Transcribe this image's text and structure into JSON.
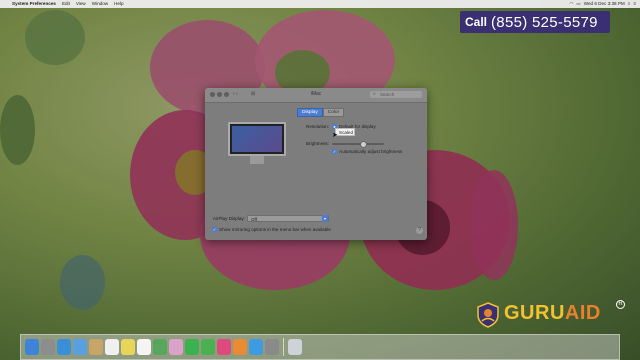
{
  "menubar": {
    "app_name": "System Preferences",
    "items": [
      "Edit",
      "View",
      "Window",
      "Help"
    ],
    "clock": "Wed 6 Dec  3:38 PM"
  },
  "banner": {
    "call_label": "Call",
    "phone": "(855)  525-5579"
  },
  "window": {
    "title": "iMac",
    "search_placeholder": "Search",
    "tabs": [
      {
        "label": "Display",
        "active": true
      },
      {
        "label": "Color",
        "active": false
      }
    ],
    "resolution_label": "Resolution:",
    "default_option": "Default for display",
    "scaled_option": "Scaled",
    "brightness_label": "Brightness:",
    "brightness_level": 0.62,
    "auto_brightness_label": "Automatically adjust brightness",
    "airplay_label": "AirPlay Display:",
    "airplay_value": "Off",
    "mirroring_label": "Show mirroring options in the menu bar when available",
    "help": "?"
  },
  "logo": {
    "part1": "GURU",
    "part2": "AID",
    "registered": "R"
  },
  "colors": {
    "accent": "#4d7dd0",
    "banner": "#3b2f74",
    "logo_gold": "#f2c230",
    "logo_orange": "#e6822e"
  },
  "dock": {
    "icons": [
      "finder-icon",
      "launchpad-icon",
      "safari-icon",
      "mail-icon",
      "contacts-icon",
      "calendar-icon",
      "notes-icon",
      "reminders-icon",
      "maps-icon",
      "photos-icon",
      "messages-icon",
      "facetime-icon",
      "itunes-icon",
      "ibooks-icon",
      "app-store-icon",
      "system-preferences-icon",
      "trash-icon"
    ]
  }
}
